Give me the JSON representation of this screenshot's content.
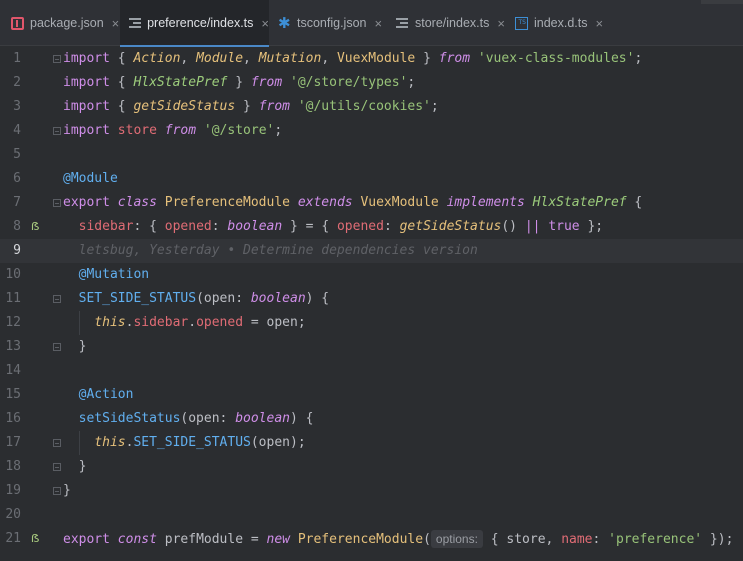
{
  "tabs": [
    {
      "label": "package.json",
      "icon": "npm-package-icon",
      "active": false
    },
    {
      "label": "preference/index.ts",
      "icon": "structure-icon",
      "active": true
    },
    {
      "label": "tsconfig.json",
      "icon": "gear-icon",
      "active": false
    },
    {
      "label": "store/index.ts",
      "icon": "structure-icon",
      "active": false
    },
    {
      "label": "index.d.ts",
      "icon": "ts-file-icon",
      "active": false
    }
  ],
  "close_glyph": "×",
  "line_numbers": [
    "1",
    "2",
    "3",
    "4",
    "5",
    "6",
    "7",
    "8",
    "9",
    "10",
    "11",
    "12",
    "13",
    "14",
    "15",
    "16",
    "17",
    "18",
    "19",
    "20",
    "21"
  ],
  "current_line": "9",
  "code": {
    "l1": {
      "kw1": "import",
      "p1": " { ",
      "c1": "Action",
      "p2": ", ",
      "c2": "Module",
      "p3": ", ",
      "c3": "Mutation",
      "p4": ", ",
      "c4": "VuexModule",
      "p5": " } ",
      "kw2": "from",
      "p6": " ",
      "s": "'vuex-class-modules'",
      "p7": ";"
    },
    "l2": {
      "kw1": "import",
      "p1": " { ",
      "t1": "HlxStatePref",
      "p2": " } ",
      "kw2": "from",
      "p3": " ",
      "s": "'@/store/types'",
      "p4": ";"
    },
    "l3": {
      "kw1": "import",
      "p1": " { ",
      "f1": "getSideStatus",
      "p2": " } ",
      "kw2": "from",
      "p3": " ",
      "s": "'@/utils/cookies'",
      "p4": ";"
    },
    "l4": {
      "kw1": "import",
      "p1": " store ",
      "kw2": "from",
      "p2": " ",
      "s": "'@/store'",
      "p3": ";"
    },
    "l6": {
      "dec": "@Module"
    },
    "l7": {
      "kw1": "export",
      "p1": " ",
      "kw2": "class",
      "p2": " ",
      "c1": "PreferenceModule",
      "p3": " ",
      "kw3": "extends",
      "p4": " ",
      "c2": "VuexModule",
      "p5": " ",
      "kw4": "implements",
      "p6": " ",
      "t1": "HlxStatePref",
      "p7": " {"
    },
    "l8": {
      "ind": "  ",
      "pr1": "sidebar",
      "p1": ": { ",
      "pr2": "opened",
      "p2": ": ",
      "ty": "boolean",
      "p3": " } = { ",
      "pr3": "opened",
      "p4": ": ",
      "f1": "getSideStatus",
      "p5": "() ",
      "op": "||",
      "p6": " ",
      "kw": "true",
      "p7": " };"
    },
    "l9": {
      "ann": "  letsbug, Yesterday • Determine dependencies version"
    },
    "l10": {
      "ind": "  ",
      "dec": "@Mutation"
    },
    "l11": {
      "ind": "  ",
      "fn": "SET_SIDE_STATUS",
      "p1": "(open: ",
      "ty": "boolean",
      "p2": ") {"
    },
    "l12": {
      "ind": "    ",
      "kw": "this",
      "p1": ".",
      "pr1": "sidebar",
      "p2": ".",
      "pr2": "opened",
      "p3": " = open;"
    },
    "l13": {
      "ind": "  ",
      "p1": "}"
    },
    "l15": {
      "ind": "  ",
      "dec": "@Action"
    },
    "l16": {
      "ind": "  ",
      "fn": "setSideStatus",
      "p1": "(open: ",
      "ty": "boolean",
      "p2": ") {"
    },
    "l17": {
      "ind": "    ",
      "kw": "this",
      "p1": ".",
      "fn": "SET_SIDE_STATUS",
      "p2": "(open);"
    },
    "l18": {
      "ind": "  ",
      "p1": "}"
    },
    "l19": {
      "p1": "}"
    },
    "l21": {
      "kw1": "export",
      "p1": " ",
      "kw2": "const",
      "p2": " prefModule = ",
      "kw3": "new",
      "p3": " ",
      "c1": "PreferenceModule",
      "p4": "(",
      "hint": "options:",
      "p5": " { store, ",
      "pr1": "name",
      "p6": ": ",
      "s": "'preference'",
      "p7": " });"
    }
  },
  "vcs_marker": "ẞ",
  "colors": {
    "accent": "#4a88c7",
    "keyword": "#cf8ee8",
    "string": "#98c379",
    "class": "#e5c07b",
    "function": "#61afef",
    "property": "#e06c75",
    "background": "#2b2d30"
  }
}
